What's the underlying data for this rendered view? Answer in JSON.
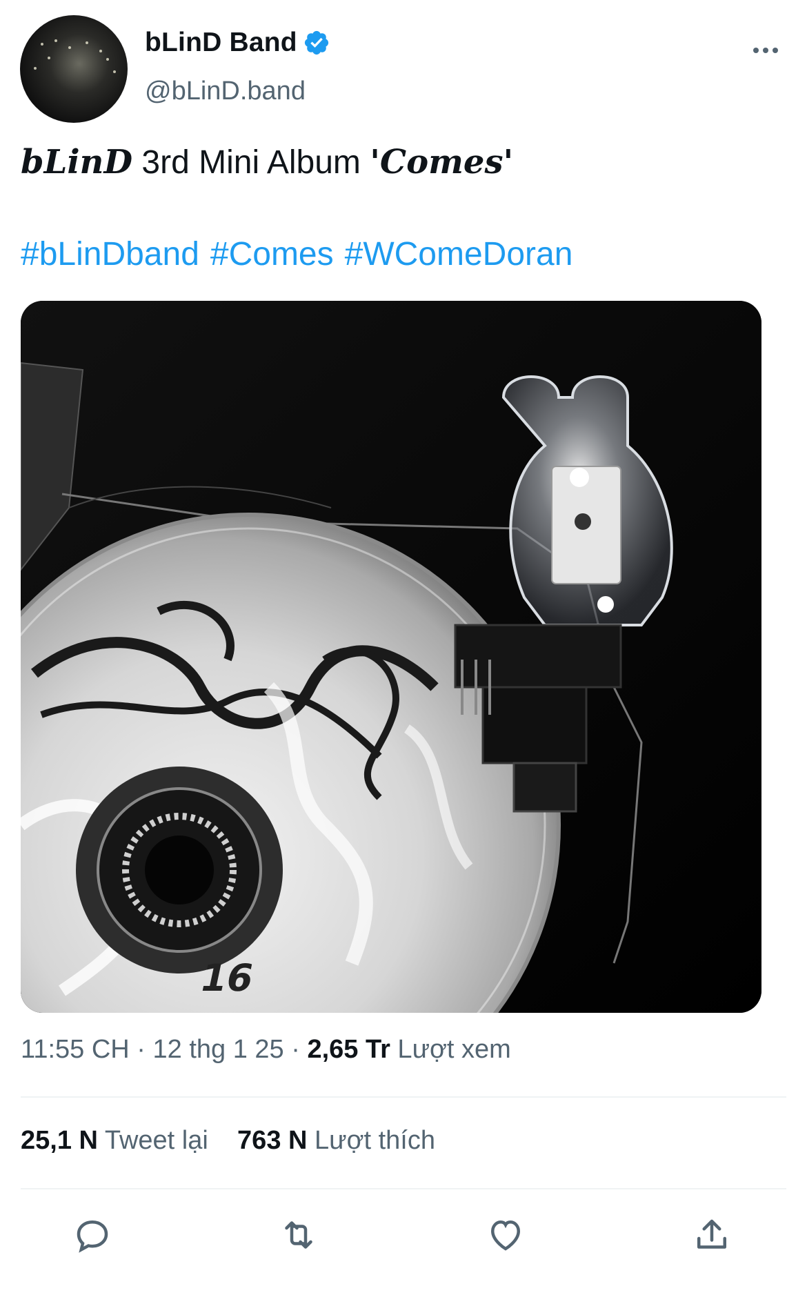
{
  "header": {
    "display_name": "bLinD Band",
    "handle": "@bLinD.band",
    "verified_icon": "verified-badge-icon",
    "more_icon": "more-options-icon"
  },
  "tweet": {
    "text_brand": "bLinD",
    "text_middle": " 3rd Mini Album ",
    "text_quote_open": "'",
    "text_title": "Comes",
    "text_quote_close": "'",
    "hashtags": [
      "#bLinDband",
      "#Comes",
      "#WComeDoran"
    ]
  },
  "meta": {
    "time": "11:55 CH",
    "sep1": " · ",
    "date": "12 thg 1 25",
    "sep2": " · ",
    "views_count": "2,65 Tr",
    "views_label": " Lượt xem"
  },
  "stats": {
    "retweets_count": "25,1 N",
    "retweets_label": " Tweet lại",
    "likes_count": "763 N",
    "likes_label": " Lượt thích"
  },
  "actions": {
    "reply_icon": "reply-icon",
    "retweet_icon": "retweet-icon",
    "like_icon": "heart-icon",
    "share_icon": "share-icon"
  },
  "colors": {
    "link": "#1d9bf0",
    "secondary_text": "#536471",
    "primary_text": "#0f1419",
    "divider": "#eff3f4"
  }
}
